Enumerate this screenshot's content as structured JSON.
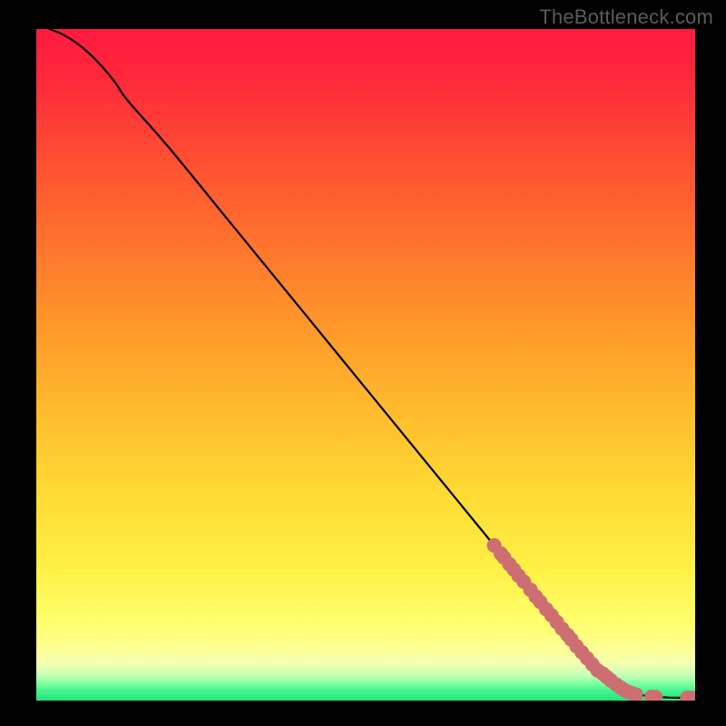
{
  "watermark": "TheBottleneck.com",
  "gradient_stops": [
    {
      "offset": 0.0,
      "color": "#ff1a40"
    },
    {
      "offset": 0.08,
      "color": "#ff2a3a"
    },
    {
      "offset": 0.18,
      "color": "#ff4a33"
    },
    {
      "offset": 0.3,
      "color": "#ff6e2d"
    },
    {
      "offset": 0.42,
      "color": "#ff912a"
    },
    {
      "offset": 0.55,
      "color": "#ffb62c"
    },
    {
      "offset": 0.68,
      "color": "#ffd833"
    },
    {
      "offset": 0.8,
      "color": "#fff045"
    },
    {
      "offset": 0.88,
      "color": "#ffff6a"
    },
    {
      "offset": 0.92,
      "color": "#ffff91"
    },
    {
      "offset": 0.945,
      "color": "#f4ffb2"
    },
    {
      "offset": 0.962,
      "color": "#c7ffb3"
    },
    {
      "offset": 0.975,
      "color": "#7dffa2"
    },
    {
      "offset": 0.985,
      "color": "#45f58e"
    },
    {
      "offset": 1.0,
      "color": "#22e37c"
    }
  ],
  "chart_data": {
    "type": "line",
    "title": "",
    "xlabel": "",
    "ylabel": "",
    "xlim": [
      0,
      100
    ],
    "ylim": [
      0,
      100
    ],
    "series": [
      {
        "name": "curve",
        "x": [
          2,
          4,
          6,
          8,
          10,
          12,
          14,
          20,
          30,
          40,
          50,
          60,
          70,
          75,
          80,
          83,
          86,
          88,
          90,
          92,
          94,
          96,
          98,
          100
        ],
        "y": [
          100,
          99.2,
          98,
          96.4,
          94.4,
          92,
          89.2,
          82.5,
          70.5,
          58.5,
          46.5,
          34.5,
          22.5,
          16.5,
          10.5,
          7.0,
          4.0,
          2.4,
          1.3,
          0.8,
          0.55,
          0.45,
          0.42,
          0.4
        ]
      }
    ],
    "points": {
      "name": "dots",
      "color": "#cd6f72",
      "radius": 8,
      "x": [
        69.5,
        70.5,
        71.0,
        71.8,
        72.5,
        73.2,
        74.0,
        75.0,
        75.8,
        76.5,
        77.4,
        78.2,
        79.0,
        79.8,
        80.6,
        81.2,
        82.0,
        82.8,
        83.6,
        84.4,
        85.2,
        86.0,
        86.6,
        87.2,
        88.0,
        88.6,
        89.2,
        89.8,
        90.4,
        91.0,
        93.4,
        94.0,
        98.8,
        99.4
      ],
      "y": [
        23.1,
        21.9,
        21.3,
        20.3,
        19.5,
        18.6,
        17.7,
        16.5,
        15.5,
        14.7,
        13.6,
        12.7,
        11.7,
        10.7,
        9.8,
        9.1,
        8.1,
        7.2,
        6.3,
        5.4,
        4.5,
        4.0,
        3.5,
        3.0,
        2.4,
        2.0,
        1.6,
        1.3,
        1.1,
        0.9,
        0.55,
        0.52,
        0.42,
        0.41
      ]
    }
  }
}
